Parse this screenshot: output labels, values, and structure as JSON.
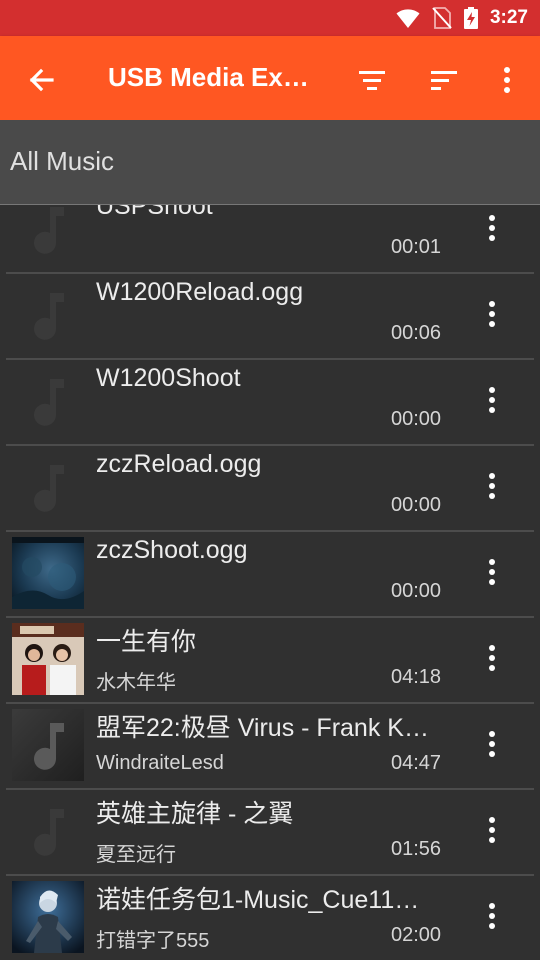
{
  "status_bar": {
    "time": "3:27"
  },
  "app_bar": {
    "title": "USB Media Ex…",
    "icons": [
      "arrow-back-icon",
      "filter-icon",
      "sort-icon",
      "more-vert-icon"
    ]
  },
  "subheader": {
    "label": "All Music"
  },
  "tracks": [
    {
      "title": "USPShoot",
      "artist": "",
      "duration": "00:01",
      "thumb": "note"
    },
    {
      "title": "W1200Reload.ogg",
      "artist": "",
      "duration": "00:06",
      "thumb": "note"
    },
    {
      "title": "W1200Shoot",
      "artist": "",
      "duration": "00:00",
      "thumb": "note"
    },
    {
      "title": "zczReload.ogg",
      "artist": "",
      "duration": "00:00",
      "thumb": "note"
    },
    {
      "title": "zczShoot.ogg",
      "artist": "",
      "duration": "00:00",
      "thumb": "art-blue"
    },
    {
      "title": "一生有你",
      "artist": "水木年华",
      "duration": "04:18",
      "thumb": "art-duo"
    },
    {
      "title": "盟军22:极昼 Virus - Frank K…",
      "artist": "WindraiteLesd",
      "duration": "04:47",
      "thumb": "art-note-grey"
    },
    {
      "title": "英雄主旋律 - 之翼",
      "artist": "夏至远行",
      "duration": "01:56",
      "thumb": "note"
    },
    {
      "title": "诺娃任务包1-Music_Cue11…",
      "artist": "打错字了555",
      "duration": "02:00",
      "thumb": "art-nova"
    }
  ]
}
